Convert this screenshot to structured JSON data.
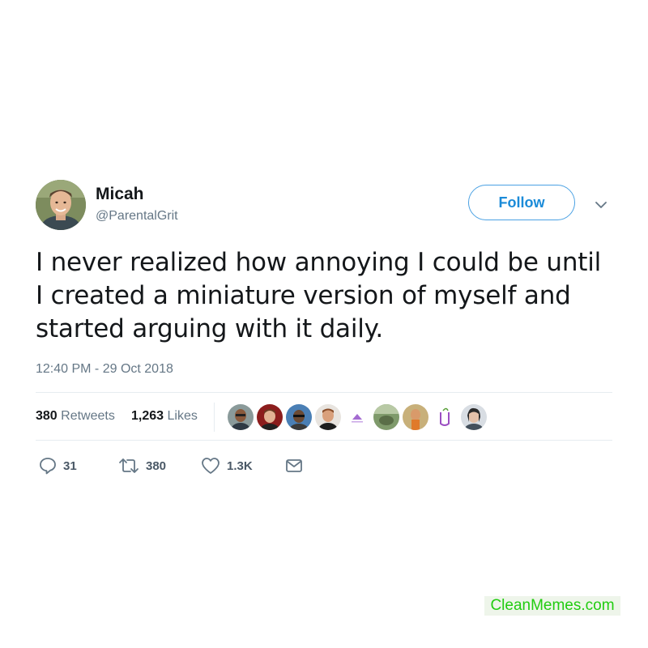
{
  "tweet": {
    "author": {
      "name": "Micah",
      "handle": "@ParentalGrit"
    },
    "follow_label": "Follow",
    "text": "I never realized how annoying I could be until I created a miniature version of myself and started arguing with it daily.",
    "timestamp": "12:40 PM - 29 Oct 2018",
    "stats": {
      "retweets_count": "380",
      "retweets_label": "Retweets",
      "likes_count": "1,263",
      "likes_label": "Likes"
    },
    "liked_by_avatars": [
      "avatar-1",
      "avatar-2",
      "avatar-3",
      "avatar-4",
      "avatar-5",
      "avatar-6",
      "avatar-7",
      "avatar-8",
      "avatar-9"
    ],
    "actions": {
      "replies": "31",
      "retweets": "380",
      "likes": "1.3K"
    },
    "icons": {
      "reply": "reply-icon",
      "retweet": "retweet-icon",
      "like": "heart-icon",
      "message": "envelope-icon",
      "more": "chevron-down-icon"
    },
    "colors": {
      "accent": "#1b8bd8",
      "muted": "#657786",
      "text": "#14171a"
    }
  },
  "watermark": "CleanMemes.com"
}
